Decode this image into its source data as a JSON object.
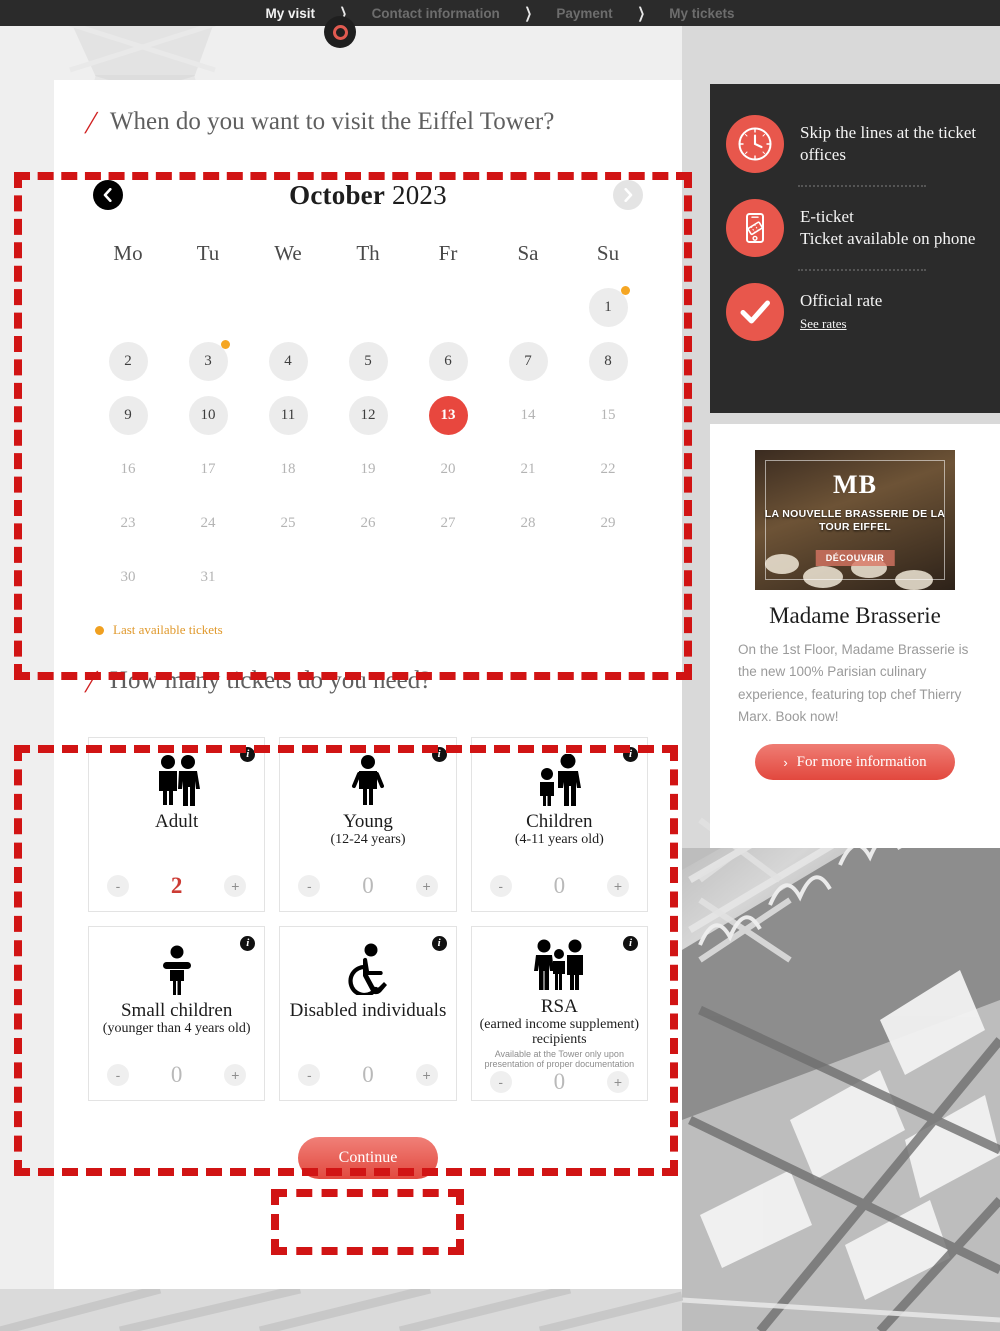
{
  "nav": {
    "steps": [
      {
        "label": "My visit",
        "active": true
      },
      {
        "label": "Contact information",
        "active": false
      },
      {
        "label": "Payment",
        "active": false
      },
      {
        "label": "My tickets",
        "active": false
      }
    ],
    "separator": "❯"
  },
  "date_section": {
    "title": "When do you want to visit the Eiffel Tower?",
    "slash": "/",
    "calendar": {
      "month": "October",
      "year": "2023",
      "prev_icon": "chevron-left-icon",
      "next_icon": "chevron-right-icon",
      "weekdays": [
        "Mo",
        "Tu",
        "We",
        "Th",
        "Fr",
        "Sa",
        "Su"
      ],
      "leading_blanks": 6,
      "days": [
        {
          "n": "1",
          "state": "available",
          "dot": true
        },
        {
          "n": "2",
          "state": "available",
          "dot": false
        },
        {
          "n": "3",
          "state": "available",
          "dot": true
        },
        {
          "n": "4",
          "state": "available",
          "dot": false
        },
        {
          "n": "5",
          "state": "available",
          "dot": false
        },
        {
          "n": "6",
          "state": "available",
          "dot": false
        },
        {
          "n": "7",
          "state": "available",
          "dot": false
        },
        {
          "n": "8",
          "state": "available",
          "dot": false
        },
        {
          "n": "9",
          "state": "available",
          "dot": false
        },
        {
          "n": "10",
          "state": "available",
          "dot": false
        },
        {
          "n": "11",
          "state": "available",
          "dot": false
        },
        {
          "n": "12",
          "state": "available",
          "dot": false
        },
        {
          "n": "13",
          "state": "selected",
          "dot": false
        },
        {
          "n": "14",
          "state": "disabled",
          "dot": false
        },
        {
          "n": "15",
          "state": "disabled",
          "dot": false
        },
        {
          "n": "16",
          "state": "disabled",
          "dot": false
        },
        {
          "n": "17",
          "state": "disabled",
          "dot": false
        },
        {
          "n": "18",
          "state": "disabled",
          "dot": false
        },
        {
          "n": "19",
          "state": "disabled",
          "dot": false
        },
        {
          "n": "20",
          "state": "disabled",
          "dot": false
        },
        {
          "n": "21",
          "state": "disabled",
          "dot": false
        },
        {
          "n": "22",
          "state": "disabled",
          "dot": false
        },
        {
          "n": "23",
          "state": "disabled",
          "dot": false
        },
        {
          "n": "24",
          "state": "disabled",
          "dot": false
        },
        {
          "n": "25",
          "state": "disabled",
          "dot": false
        },
        {
          "n": "26",
          "state": "disabled",
          "dot": false
        },
        {
          "n": "27",
          "state": "disabled",
          "dot": false
        },
        {
          "n": "28",
          "state": "disabled",
          "dot": false
        },
        {
          "n": "29",
          "state": "disabled",
          "dot": false
        },
        {
          "n": "30",
          "state": "disabled",
          "dot": false
        },
        {
          "n": "31",
          "state": "disabled",
          "dot": false
        }
      ],
      "legend": "Last available tickets",
      "legend_color": "#f0a020",
      "selected_color": "#e8473e"
    }
  },
  "ticket_section": {
    "title": "How many tickets do you need?",
    "slash": "/",
    "info_icon": "info-icon",
    "minus_label": "-",
    "plus_label": "+",
    "tickets": [
      {
        "icon": "two-adults-icon",
        "label": "Adult",
        "sub": "",
        "note": "",
        "value": "2"
      },
      {
        "icon": "youth-icon",
        "label": "Young",
        "sub": "(12-24 years)",
        "note": "",
        "value": "0"
      },
      {
        "icon": "adult-child-icon",
        "label": "Children",
        "sub": "(4-11 years old)",
        "note": "",
        "value": "0"
      },
      {
        "icon": "toddler-icon",
        "label": "Small children",
        "sub": "(younger than 4 years old)",
        "note": "",
        "value": "0"
      },
      {
        "icon": "wheelchair-icon",
        "label": "Disabled individuals",
        "sub": "",
        "note": "",
        "value": "0"
      },
      {
        "icon": "family-icon",
        "label": "RSA",
        "sub": "(earned income supplement) recipients",
        "note": "Available at the Tower only upon presentation of proper documentation",
        "value": "0"
      }
    ],
    "continue_label": "Continue"
  },
  "benefits": {
    "items": [
      {
        "icon": "clock-icon",
        "title": "Skip the lines at the ticket offices",
        "link": ""
      },
      {
        "icon": "phone-ticket-icon",
        "title": "E-ticket\nTicket available on phone",
        "link": ""
      },
      {
        "icon": "check-icon",
        "title": "Official rate",
        "link": "See rates"
      }
    ],
    "accent_color": "#e8574c",
    "bg_color": "#2b2b2b"
  },
  "promo": {
    "image_logo": "MB",
    "image_title": "LA NOUVELLE BRASSERIE DE LA TOUR EIFFEL",
    "image_cta": "DÉCOUVRIR",
    "title": "Madame Brasserie",
    "text": "On the 1st Floor, Madame Brasserie is the new 100% Parisian culinary experience, featuring top chef Thierry Marx. Book now!",
    "button": "For more information",
    "button_chevron": "›"
  },
  "annotations": {
    "color": "#d11414",
    "boxes": [
      "calendar-region",
      "ticket-region",
      "continue-region"
    ]
  }
}
